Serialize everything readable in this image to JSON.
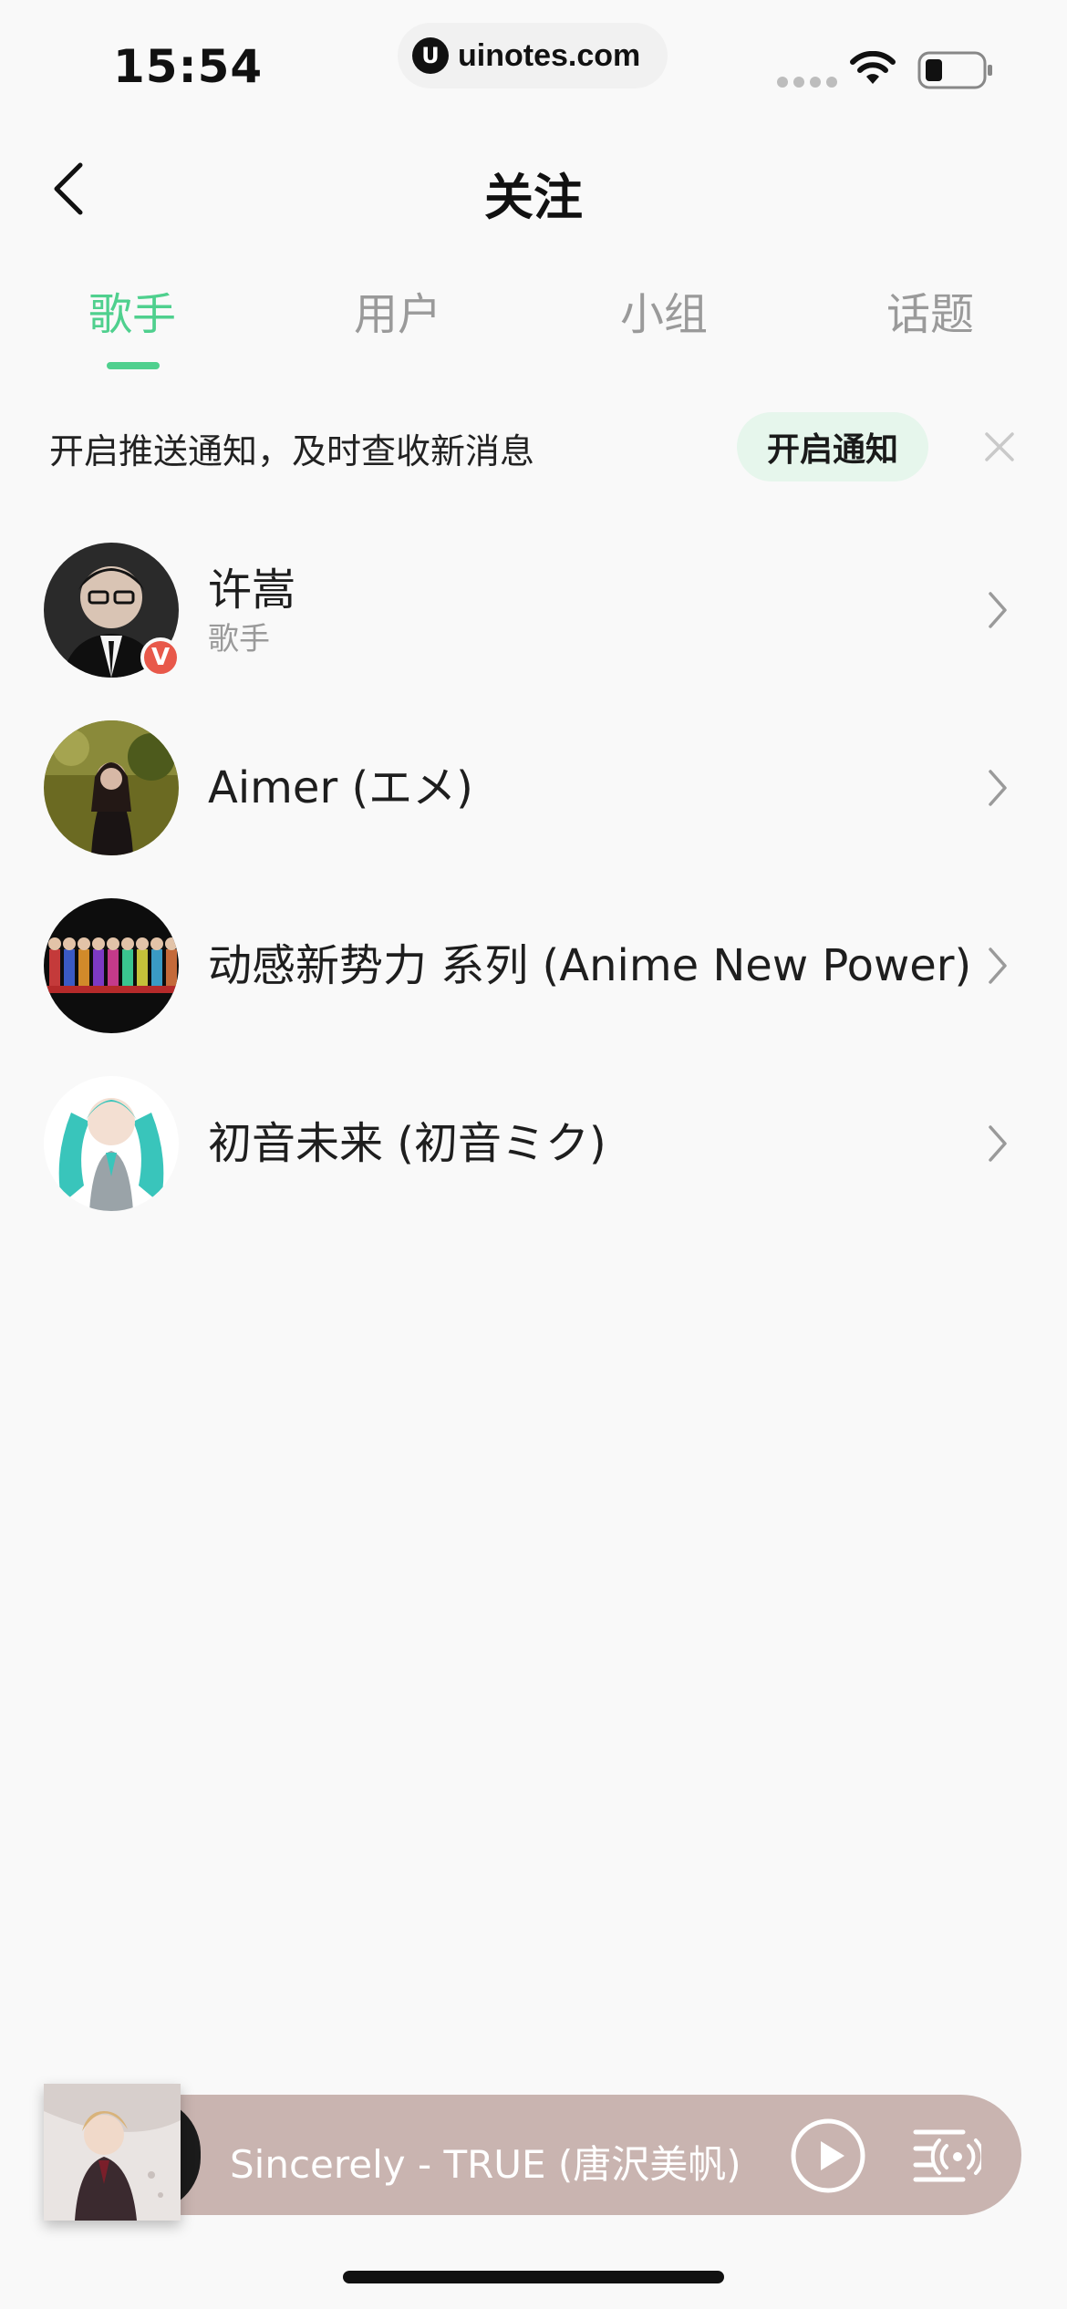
{
  "status_bar": {
    "time": "15:54",
    "url": "uinotes.com",
    "url_logo": "U"
  },
  "nav": {
    "title": "关注",
    "back_icon": "chevron-left-icon"
  },
  "tabs": [
    {
      "label": "歌手",
      "active": true
    },
    {
      "label": "用户",
      "active": false
    },
    {
      "label": "小组",
      "active": false
    },
    {
      "label": "话题",
      "active": false
    }
  ],
  "notification": {
    "text": "开启推送通知，及时查收新消息",
    "button": "开启通知",
    "close_icon": "close-icon"
  },
  "artists": [
    {
      "name": "许嵩",
      "subtitle": "歌手",
      "verified": true,
      "badge": "V"
    },
    {
      "name": "Aimer (エメ)",
      "subtitle": "",
      "verified": false
    },
    {
      "name": "动感新势力 系列 (Anime New Power)",
      "subtitle": "",
      "verified": false
    },
    {
      "name": "初音未来 (初音ミク)",
      "subtitle": "",
      "verified": false
    }
  ],
  "player": {
    "now_playing": "Sincerely - TRUE (唐沢美帆)",
    "play_icon": "play-icon",
    "playlist_icon": "playlist-icon"
  },
  "colors": {
    "accent": "#4fd08e",
    "badge": "#e8584a",
    "player_bg": "#c9b4b0"
  }
}
